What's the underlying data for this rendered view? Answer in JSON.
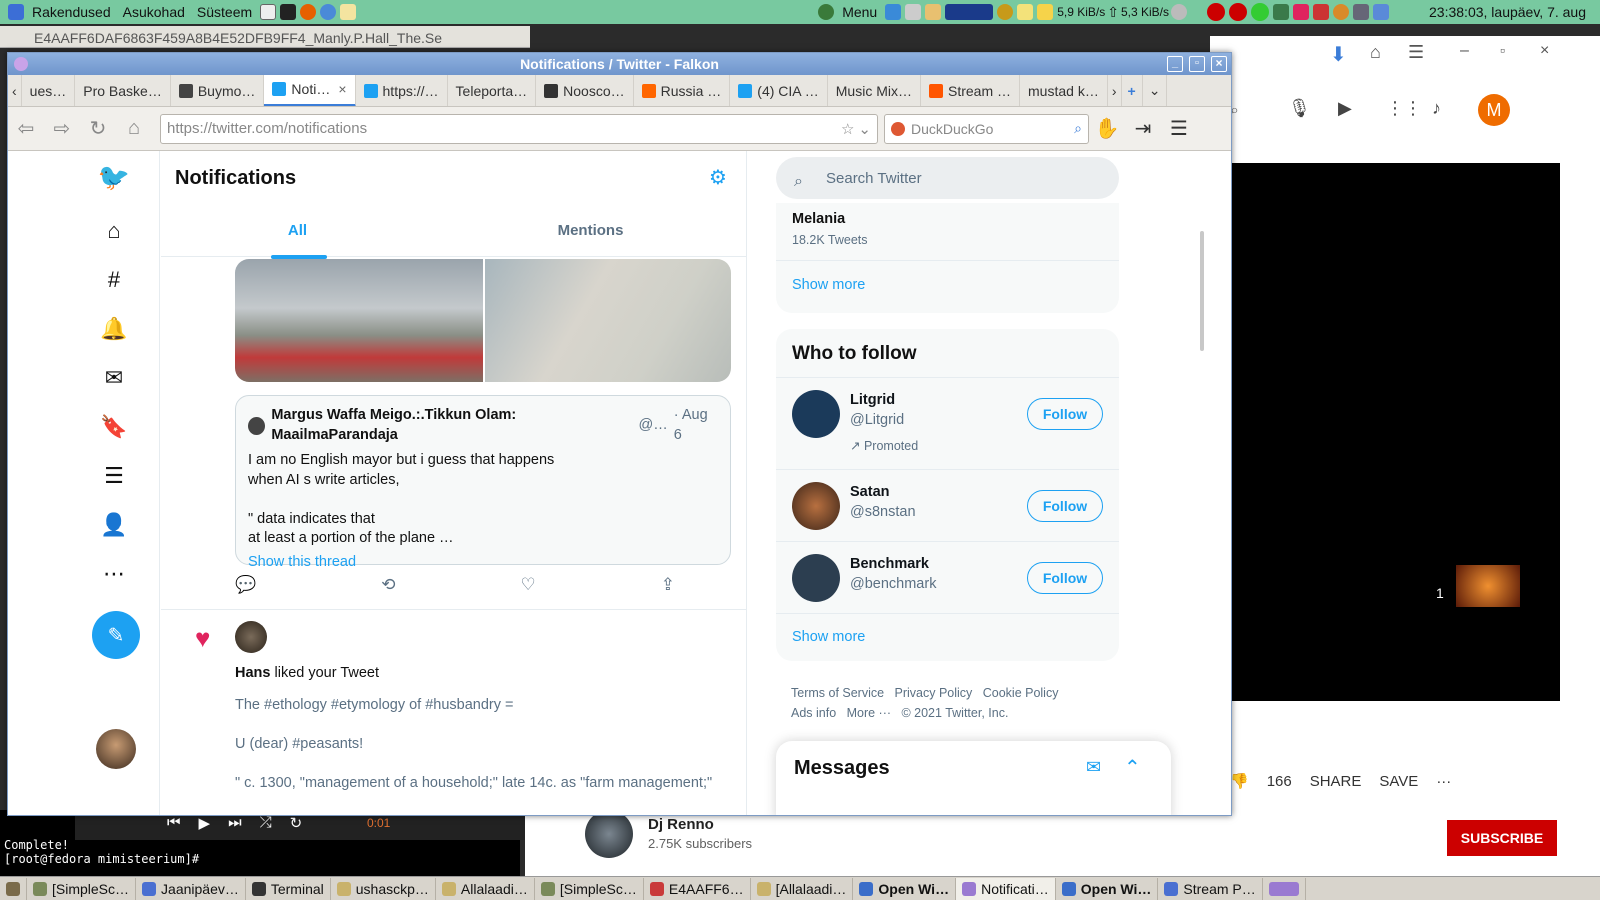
{
  "top_panel": {
    "menus": [
      "Rakendused",
      "Asukohad",
      "Süsteem"
    ],
    "menu_label": "Menu",
    "net_down": "5,9 KiB/s",
    "net_up": "5,3 KiB/s",
    "clock": "23:38:03, laupäev,  7. aug"
  },
  "bg_window_title": "E4AAFF6DAF6863F459A8B4E52DFB9FF4_Manly.P.Hall_The.Se",
  "browser": {
    "window_title": "Notifications / Twitter - Falkon",
    "tabs": [
      {
        "label": "ues…",
        "color": ""
      },
      {
        "label": "Pro Baske…",
        "color": ""
      },
      {
        "label": "Buymo…",
        "color": "#444"
      },
      {
        "label": "Noti…",
        "color": "#1da1f2",
        "active": true
      },
      {
        "label": "https://…",
        "color": "#1da1f2"
      },
      {
        "label": "Teleporta…",
        "color": ""
      },
      {
        "label": "Noosco…",
        "color": "#333"
      },
      {
        "label": "Russia …",
        "color": "#ff6600"
      },
      {
        "label": "(4) CIA …",
        "color": "#1da1f2"
      },
      {
        "label": "Music Mix…",
        "color": ""
      },
      {
        "label": "Stream …",
        "color": "#ff5500"
      },
      {
        "label": "mustad k…",
        "color": ""
      }
    ],
    "url_prefix": "https://twitter.com",
    "url_path": "/notifications",
    "search_engine": "DuckDuckGo"
  },
  "twitter": {
    "page_title": "Notifications",
    "tabs": {
      "all": "All",
      "mentions": "Mentions"
    },
    "quote": {
      "author": "Margus Waffa Meigo.:.Tikkun Olam: MaailmaParandaja",
      "handle": "@…",
      "date": "· Aug 6",
      "lines": [
        "I am no English mayor but i guess that happens",
        "when AI s write articles,",
        "",
        "\" data indicates that",
        "at least a portion of the plane …"
      ],
      "show_thread": "Show this thread"
    },
    "like_notification": {
      "user": "Hans",
      "action": " liked your Tweet",
      "lines": [
        "The #ethology  #etymology of #husbandry =",
        "U (dear) #peasants!",
        "\" c. 1300, \"management of a household;\" late 14c. as \"farm management;\""
      ]
    },
    "search_placeholder": "Search Twitter",
    "trend": {
      "name": "Melania",
      "count": "18.2K Tweets",
      "show_more": "Show more"
    },
    "who_to_follow": {
      "title": "Who to follow",
      "items": [
        {
          "name": "Litgrid",
          "handle": "@Litgrid",
          "promoted": "Promoted",
          "follow": "Follow"
        },
        {
          "name": "Satan",
          "handle": "@s8nstan",
          "follow": "Follow"
        },
        {
          "name": "Benchmark",
          "handle": "@benchmark",
          "follow": "Follow"
        }
      ],
      "show_more": "Show more"
    },
    "footer": [
      "Terms of Service",
      "Privacy Policy",
      "Cookie Policy",
      "Ads info",
      "More ···",
      "© 2021 Twitter, Inc."
    ],
    "messages": "Messages"
  },
  "youtube": {
    "avatar_letter": "M",
    "video_counter": "1",
    "dislikes": "166",
    "share": "SHARE",
    "save": "SAVE",
    "subscribe": "SUBSCRIBE",
    "channel": "Dj Renno",
    "subscribers": "2.75K subscribers"
  },
  "terminal": {
    "lines": [
      "Complete!",
      "[root@fedora mimisteerium]# "
    ],
    "time": "0:01"
  },
  "taskbar": [
    {
      "label": "[SimpleSc…",
      "color": "#7a8a5a"
    },
    {
      "label": "Jaanipäev…",
      "color": "#4a6fd1"
    },
    {
      "label": "Terminal",
      "color": "#333"
    },
    {
      "label": "ushasckp…",
      "color": "#c9b26b"
    },
    {
      "label": "Allalaadi…",
      "color": "#c9b26b"
    },
    {
      "label": "[SimpleSc…",
      "color": "#7a8a5a"
    },
    {
      "label": "E4AAFF6…",
      "color": "#c93a3a"
    },
    {
      "label": "[Allalaadi…",
      "color": "#c9b26b"
    },
    {
      "label": "Open Wi…",
      "color": "#3a6dc9"
    },
    {
      "label": "Notificati…",
      "color": "#9a7ad1",
      "active": true
    },
    {
      "label": "Open Wi…",
      "color": "#3a6dc9"
    },
    {
      "label": "Stream P…",
      "color": "#4a6fd1"
    }
  ]
}
